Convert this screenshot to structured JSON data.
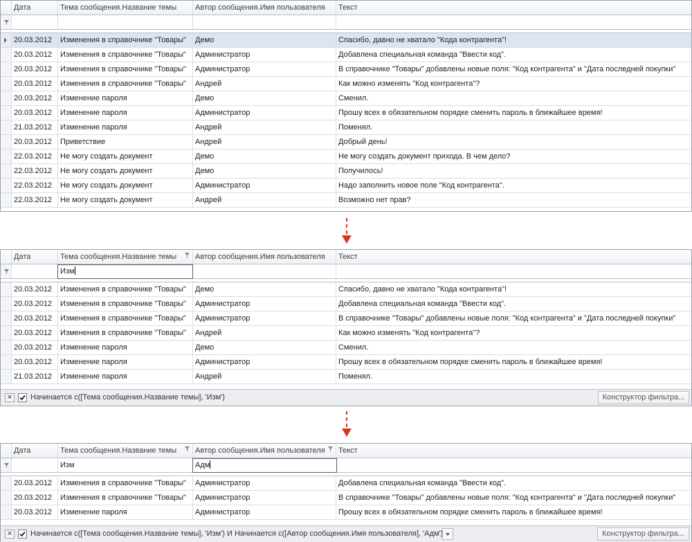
{
  "columns": {
    "date": "Дата",
    "topic": "Тема сообщения.Название темы",
    "author": "Автор сообщения.Имя пользователя",
    "text": "Текст"
  },
  "grid1": {
    "rows": [
      {
        "date": "20.03.2012",
        "topic": "Изменения в справочнике \"Товары\"",
        "author": "Демо",
        "text": "Спасибо, давно не хватало \"Кода контрагента\"!"
      },
      {
        "date": "20.03.2012",
        "topic": "Изменения в справочнике \"Товары\"",
        "author": "Администратор",
        "text": "Добавлена специальная команда \"Ввести код\"."
      },
      {
        "date": "20.03.2012",
        "topic": "Изменения в справочнике \"Товары\"",
        "author": "Администратор",
        "text": "В справочнике \"Товары\" добавлены новые поля: \"Код контрагента\" и \"Дата последней покупки\""
      },
      {
        "date": "20.03.2012",
        "topic": "Изменения в справочнике \"Товары\"",
        "author": "Андрей",
        "text": "Как можно изменять \"Код контрагента\"?"
      },
      {
        "date": "20.03.2012",
        "topic": "Изменение пароля",
        "author": "Демо",
        "text": "Сменил."
      },
      {
        "date": "20.03.2012",
        "topic": "Изменение пароля",
        "author": "Администратор",
        "text": "Прошу всех в обязательном порядке сменить пароль в ближайшее время!"
      },
      {
        "date": "21.03.2012",
        "topic": "Изменение пароля",
        "author": "Андрей",
        "text": "Поменял."
      },
      {
        "date": "20.03.2012",
        "topic": "Приветствие",
        "author": "Андрей",
        "text": "Добрый день!"
      },
      {
        "date": "22.03.2012",
        "topic": "Не могу создать документ",
        "author": "Демо",
        "text": "Не могу создать документ прихода. В чем дело?"
      },
      {
        "date": "22.03.2012",
        "topic": "Не могу создать документ",
        "author": "Демо",
        "text": "Получилось!"
      },
      {
        "date": "22.03.2012",
        "topic": "Не могу создать документ",
        "author": "Администратор",
        "text": "Надо заполнить новое поле \"Код контрагента\"."
      },
      {
        "date": "22.03.2012",
        "topic": "Не могу создать документ",
        "author": "Андрей",
        "text": "Возможно нет прав?"
      }
    ]
  },
  "grid2": {
    "filter_topic": "Изм",
    "rows": [
      {
        "date": "20.03.2012",
        "topic": "Изменения в справочнике \"Товары\"",
        "author": "Демо",
        "text": "Спасибо, давно не хватало \"Кода контрагента\"!"
      },
      {
        "date": "20.03.2012",
        "topic": "Изменения в справочнике \"Товары\"",
        "author": "Администратор",
        "text": "Добавлена специальная команда \"Ввести код\"."
      },
      {
        "date": "20.03.2012",
        "topic": "Изменения в справочнике \"Товары\"",
        "author": "Администратор",
        "text": "В справочнике \"Товары\" добавлены новые поля: \"Код контрагента\" и \"Дата последней покупки\""
      },
      {
        "date": "20.03.2012",
        "topic": "Изменения в справочнике \"Товары\"",
        "author": "Андрей",
        "text": "Как можно изменять \"Код контрагента\"?"
      },
      {
        "date": "20.03.2012",
        "topic": "Изменение пароля",
        "author": "Демо",
        "text": "Сменил."
      },
      {
        "date": "20.03.2012",
        "topic": "Изменение пароля",
        "author": "Администратор",
        "text": "Прошу всех в обязательном порядке сменить пароль в ближайшее время!"
      },
      {
        "date": "21.03.2012",
        "topic": "Изменение пароля",
        "author": "Андрей",
        "text": "Поменял."
      }
    ],
    "filter_panel_text": "Начинается с([Тема сообщения.Название темы], 'Изм')",
    "filter_builder_label": "Конструктор фильтра..."
  },
  "grid3": {
    "filter_topic": "Изм",
    "filter_author": "Адм",
    "rows": [
      {
        "date": "20.03.2012",
        "topic": "Изменения в справочнике \"Товары\"",
        "author": "Администратор",
        "text": "Добавлена специальная команда \"Ввести код\"."
      },
      {
        "date": "20.03.2012",
        "topic": "Изменения в справочнике \"Товары\"",
        "author": "Администратор",
        "text": "В справочнике \"Товары\" добавлены новые поля: \"Код контрагента\" и \"Дата последней покупки\""
      },
      {
        "date": "20.03.2012",
        "topic": "Изменение пароля",
        "author": "Администратор",
        "text": "Прошу всех в обязательном порядке сменить пароль в ближайшее время!"
      }
    ],
    "filter_panel_text": "Начинается с([Тема сообщения.Название темы], 'Изм') И Начинается с([Автор сообщения.Имя пользователя], 'Адм')",
    "filter_builder_label": "Конструктор фильтра..."
  },
  "colors": {
    "arrow": "#e0301e",
    "selected_row": "#dce6f3",
    "grid_line": "#d8dde4"
  },
  "icons": [
    "row-indicator-icon",
    "autofilter-icon",
    "column-filter-icon",
    "close-icon",
    "checkbox-checked-icon",
    "down-arrow-icon"
  ]
}
